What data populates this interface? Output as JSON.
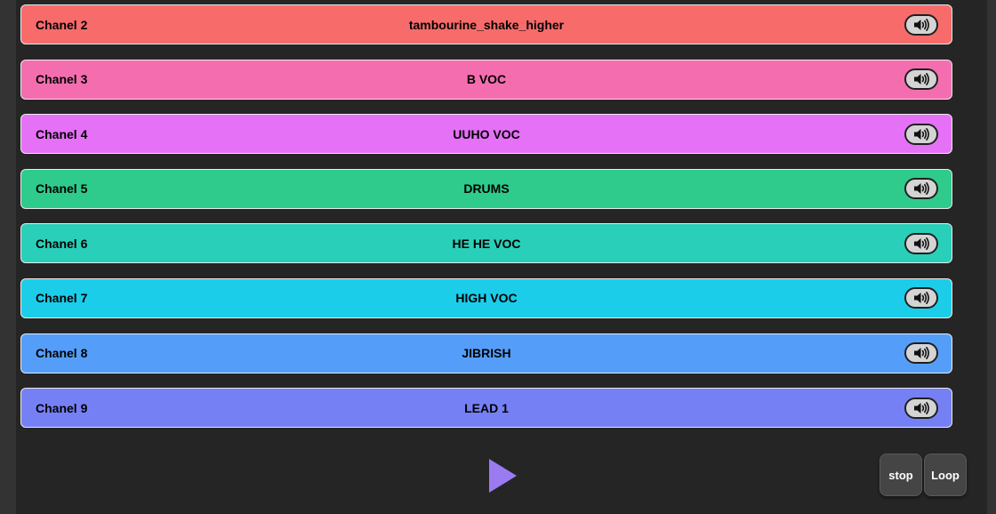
{
  "channels": [
    {
      "label": "Chanel 2",
      "track": "tambourine_shake_higher",
      "color": "#f76b6b",
      "mute_icon": "speaker-icon"
    },
    {
      "label": "Chanel 3",
      "track": "B VOC",
      "color": "#f46eaf",
      "mute_icon": "speaker-icon"
    },
    {
      "label": "Chanel 4",
      "track": "UUHO VOC",
      "color": "#e571f7",
      "mute_icon": "speaker-icon"
    },
    {
      "label": "Chanel 5",
      "track": "DRUMS",
      "color": "#2ecb8c",
      "mute_icon": "speaker-icon"
    },
    {
      "label": "Chanel 6",
      "track": "HE HE VOC",
      "color": "#29cfb9",
      "mute_icon": "speaker-icon"
    },
    {
      "label": "Chanel 7",
      "track": "HIGH VOC",
      "color": "#1ccdea",
      "mute_icon": "speaker-icon"
    },
    {
      "label": "Chanel 8",
      "track": "JIBRISH",
      "color": "#549ef9",
      "mute_icon": "speaker-icon"
    },
    {
      "label": "Chanel 9",
      "track": "LEAD 1",
      "color": "#7680f5",
      "mute_icon": "speaker-icon"
    }
  ],
  "transport": {
    "play_icon": "play-icon",
    "play_color": "#9b7bf2",
    "stop_label": "stop",
    "loop_label": "Loop"
  }
}
